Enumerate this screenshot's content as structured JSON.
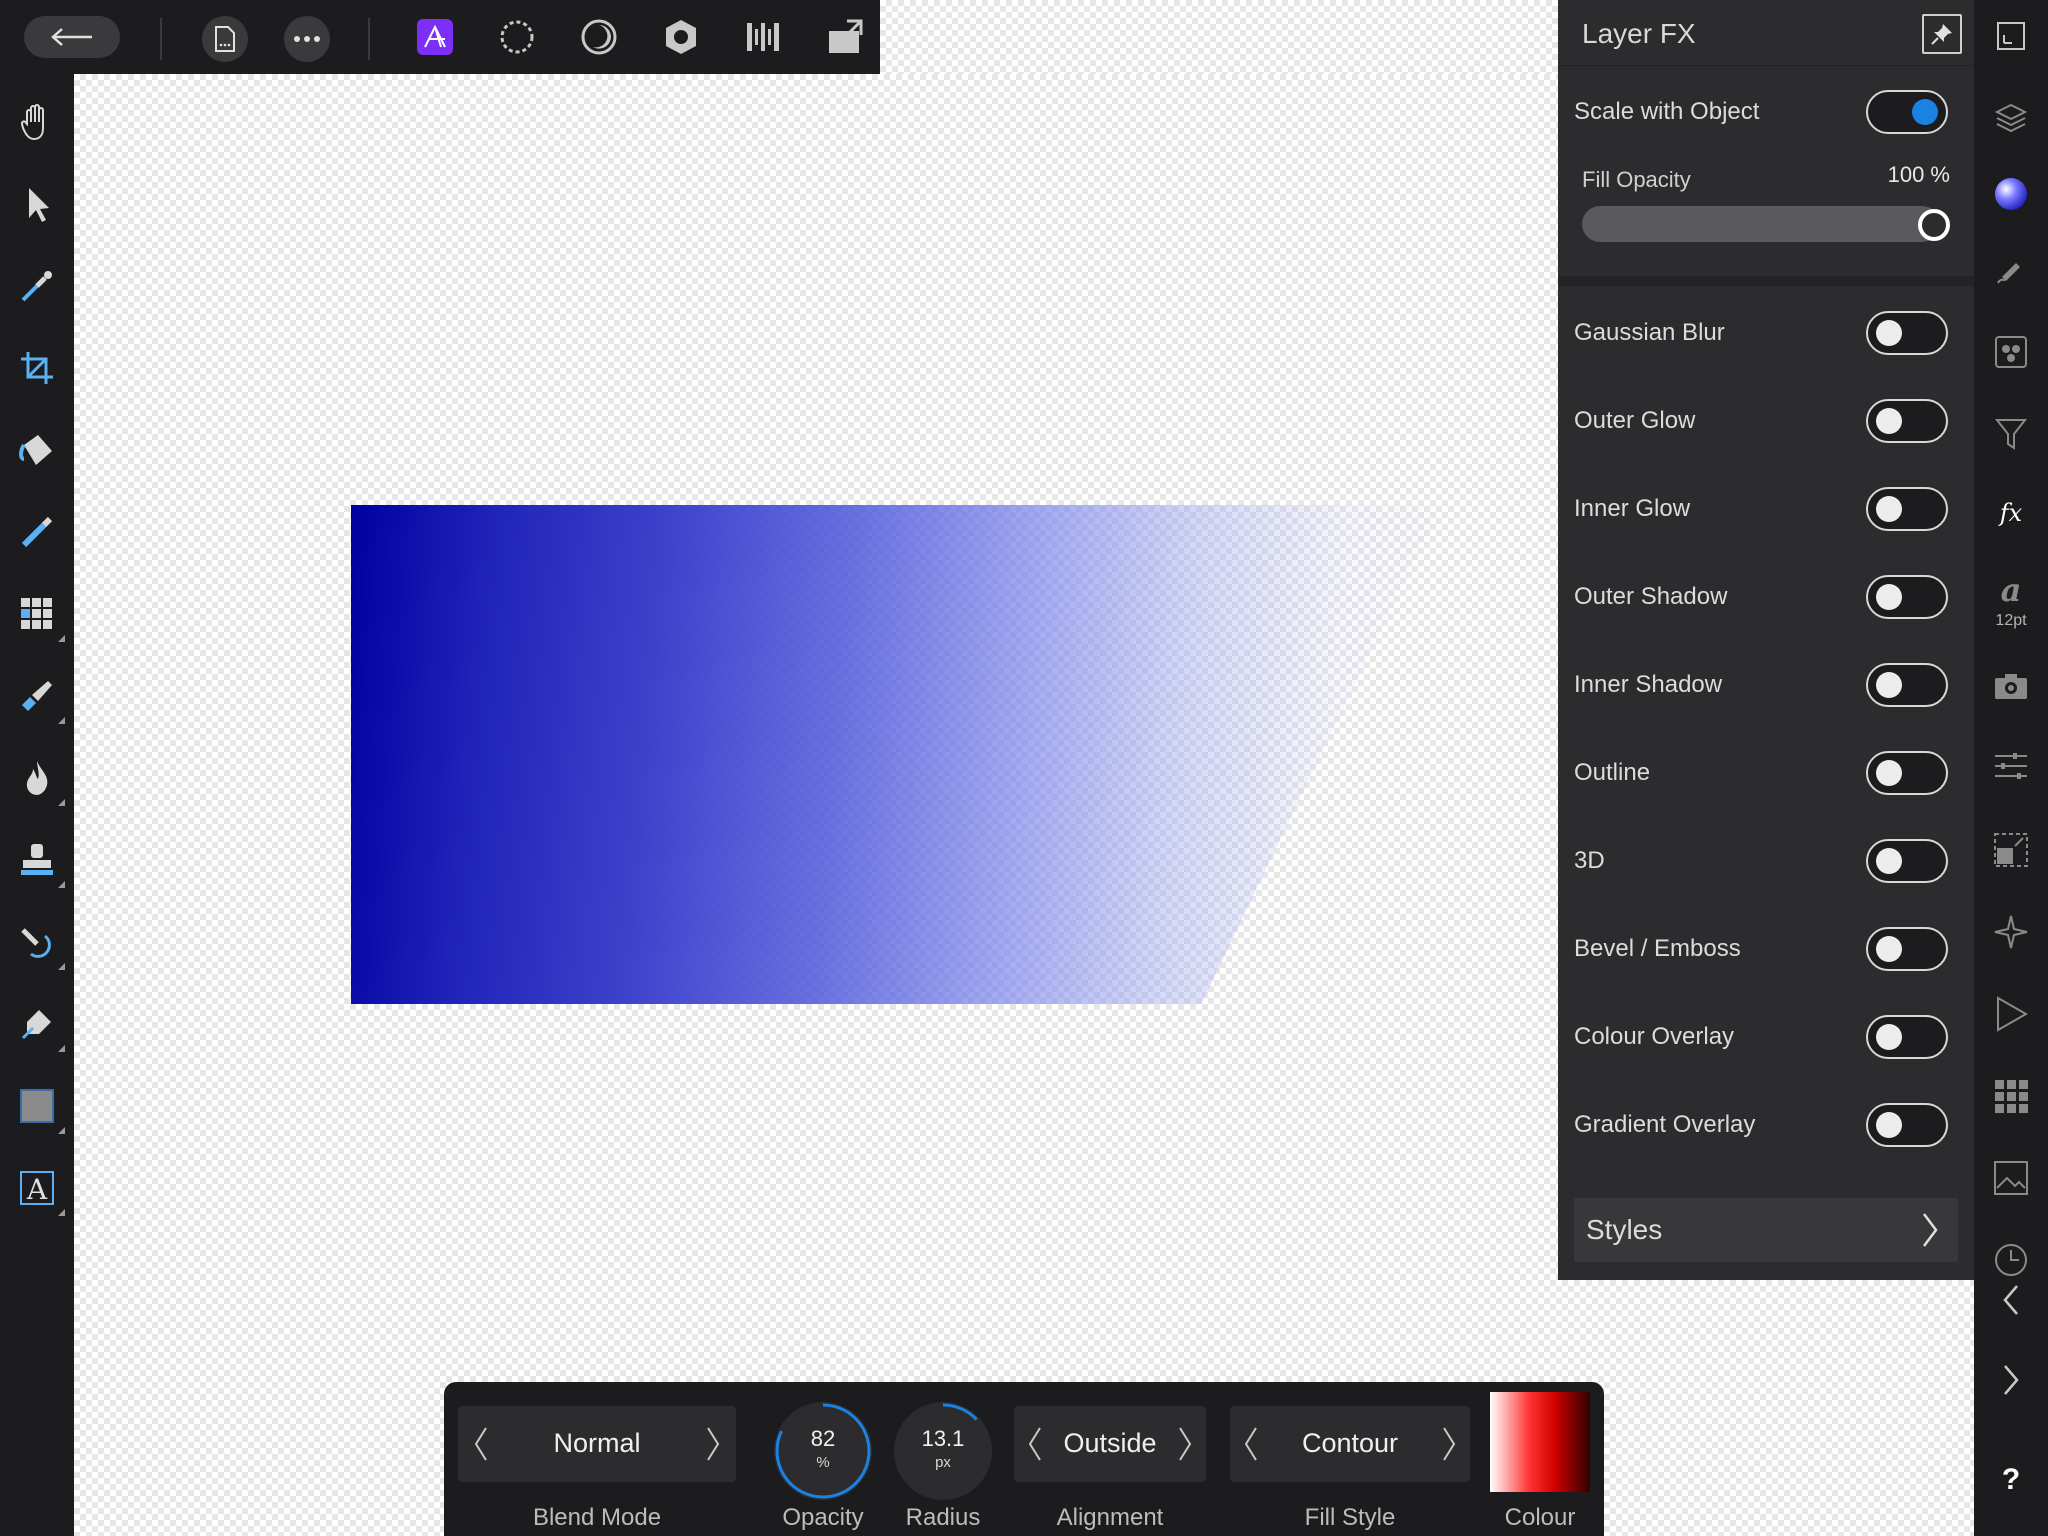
{
  "panel": {
    "title": "Layer FX",
    "scale_with_object": {
      "label": "Scale with Object",
      "on": true
    },
    "fill_opacity": {
      "label": "Fill Opacity",
      "value": "100 %",
      "fraction": 1.0
    },
    "effects": [
      {
        "label": "Gaussian Blur",
        "on": false
      },
      {
        "label": "Outer Glow",
        "on": false
      },
      {
        "label": "Inner Glow",
        "on": false
      },
      {
        "label": "Outer Shadow",
        "on": false
      },
      {
        "label": "Inner Shadow",
        "on": false
      },
      {
        "label": "Outline",
        "on": false
      },
      {
        "label": "3D",
        "on": false
      },
      {
        "label": "Bevel / Emboss",
        "on": false
      },
      {
        "label": "Colour Overlay",
        "on": false
      },
      {
        "label": "Gradient Overlay",
        "on": false
      }
    ],
    "styles_label": "Styles"
  },
  "context": {
    "blend_mode": {
      "value": "Normal",
      "caption": "Blend Mode"
    },
    "opacity": {
      "value": "82",
      "unit": "%",
      "caption": "Opacity",
      "fraction": 0.82
    },
    "radius": {
      "value": "13.1",
      "unit": "px",
      "caption": "Radius",
      "fraction": 0.13
    },
    "alignment": {
      "value": "Outside",
      "caption": "Alignment"
    },
    "fill_style": {
      "value": "Contour",
      "caption": "Fill Style"
    },
    "colour": {
      "caption": "Colour"
    }
  },
  "studio": {
    "character_size": "12pt",
    "help": "?"
  },
  "colors": {
    "accent": "#1a82e2",
    "persona_active": "#7b2ff7",
    "panel_bg": "#2c2c2e"
  },
  "icons": {
    "top_toolbar": [
      "back-arrow-icon",
      "document-icon",
      "more-icon",
      "photo-persona-icon",
      "liquify-persona-icon",
      "develop-persona-icon",
      "tone-mapping-persona-icon",
      "export-persona-icon",
      "arrange-icon"
    ],
    "left_tools": [
      "hand-icon",
      "move-icon",
      "color-picker-icon",
      "crop-icon",
      "flood-fill-icon",
      "selection-brush-icon",
      "flood-select-icon",
      "paint-brush-icon",
      "dodge-icon",
      "clone-icon",
      "healing-icon",
      "pen-icon",
      "rectangle-icon",
      "text-icon"
    ]
  }
}
